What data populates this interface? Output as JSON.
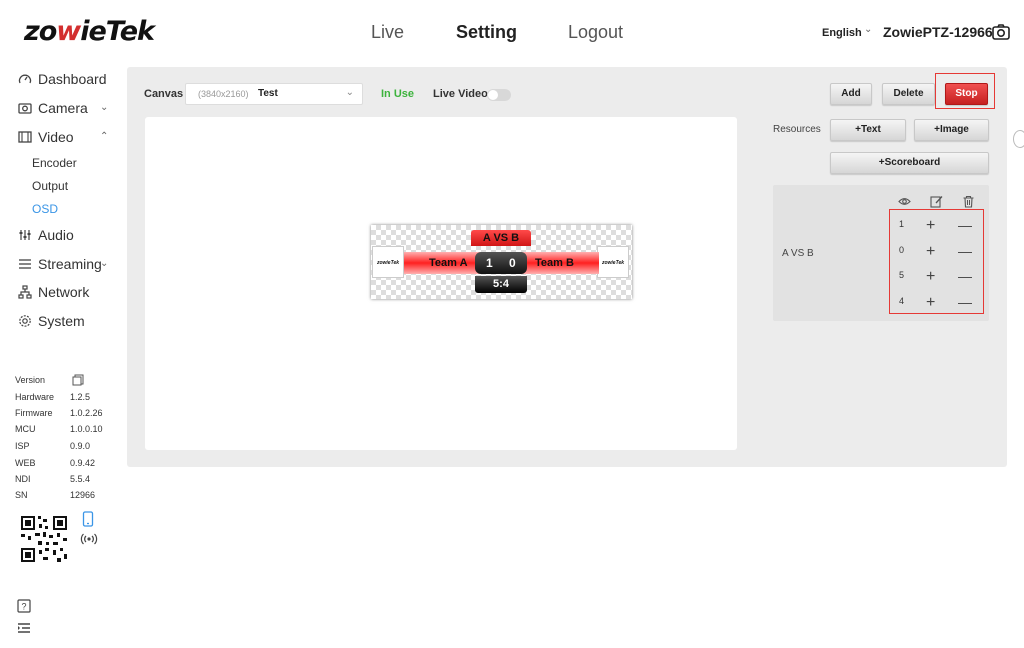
{
  "header": {
    "logo": {
      "prefix": "zo",
      "accent": "w",
      "suffix": "ieTek"
    },
    "nav": [
      "Live",
      "Setting",
      "Logout"
    ],
    "active_nav": "Setting",
    "language": "English",
    "device_name": "ZowiePTZ-12966"
  },
  "sidebar": {
    "items": [
      {
        "label": "Dashboard",
        "icon": "dashboard-icon"
      },
      {
        "label": "Camera",
        "icon": "camera-icon"
      },
      {
        "label": "Video",
        "icon": "video-icon"
      },
      {
        "label": "Audio",
        "icon": "audio-icon"
      },
      {
        "label": "Streaming",
        "icon": "streaming-icon"
      },
      {
        "label": "Network",
        "icon": "network-icon"
      },
      {
        "label": "System",
        "icon": "system-icon"
      }
    ],
    "video_sub": [
      "Encoder",
      "Output",
      "OSD"
    ],
    "active_sub": "OSD",
    "version_label": "Version",
    "versions": [
      {
        "label": "Hardware",
        "value": "1.2.5"
      },
      {
        "label": "Firmware",
        "value": "1.0.2.26"
      },
      {
        "label": "MCU",
        "value": "1.0.0.10"
      },
      {
        "label": "ISP",
        "value": "0.9.0"
      },
      {
        "label": "WEB",
        "value": "0.9.42"
      },
      {
        "label": "NDI",
        "value": "5.5.4"
      },
      {
        "label": "SN",
        "value": "12966"
      }
    ]
  },
  "toolbar": {
    "canvas_label": "Canvas",
    "canvas_resolution": "(3840x2160)",
    "canvas_name": "Test",
    "status": "In Use",
    "live_video_label": "Live Video:",
    "live_video_on": false
  },
  "scoreboard": {
    "title": "A VS B",
    "team_a": "Team A",
    "team_b": "Team B",
    "score_a": "1",
    "score_b": "0",
    "time": "5:4",
    "logo_text": "zowieTek"
  },
  "controls": {
    "add": "Add",
    "delete": "Delete",
    "stop": "Stop",
    "resources_label": "Resources",
    "add_text": "+Text",
    "add_image": "+Image",
    "add_scoreboard": "+Scoreboard"
  },
  "resource_list": {
    "item_name": "A VS B",
    "values": [
      "1",
      "0",
      "5",
      "4"
    ]
  },
  "colors": {
    "accent_red": "#d32f2f",
    "active_blue": "#3a95e6",
    "in_use_green": "#3db33d"
  }
}
